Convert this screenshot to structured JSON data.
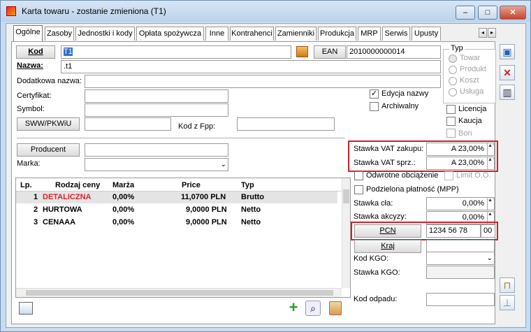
{
  "window": {
    "title": "Karta towaru - zostanie zmieniona (T1)",
    "minimize": "‒",
    "maximize": "□",
    "close": "✕"
  },
  "tabs": [
    "Ogólne",
    "Zasoby",
    "Jednostki i kody",
    "Opłata spożywcza",
    "Inne",
    "Kontrahenci",
    "Zamienniki",
    "Produkcja",
    "MRP",
    "Serwis",
    "Upusty"
  ],
  "tab_scroll": {
    "left": "◂",
    "right": "▸"
  },
  "form": {
    "kod_button": "Kod",
    "kod_value": "T1",
    "ean_button": "EAN",
    "ean_value": "2010000000014",
    "nazwa_label": "Nazwa:",
    "nazwa_value": ".t1",
    "dodatkowa_label": "Dodatkowa nazwa:",
    "certyfikat_label": "Certyfikat:",
    "symbol_label": "Symbol:",
    "sww_button": "SWW/PKWiU",
    "kod_fpp_label": "Kod z Fpp:",
    "edycja_label": "Edycja nazwy",
    "edycja_checked": "✓",
    "archiwalny_label": "Archiwalny",
    "producent_button": "Producent",
    "marka_label": "Marka:"
  },
  "typ": {
    "title": "Typ",
    "options": [
      "Towar",
      "Produkt",
      "Koszt",
      "Usługa"
    ]
  },
  "flags": [
    "Licencja",
    "Kaucja",
    "Bon"
  ],
  "vat": {
    "zakup_label": "Stawka VAT zakupu:",
    "zakup_value": "A 23,00%",
    "sprz_label": "Stawka VAT sprz.:",
    "sprz_value": "A 23,00%",
    "odwrotne_label": "Odwrotne obciążenie",
    "limit_label": "Limit O.O.",
    "podzielona_label": "Podzielona płatność (MPP)",
    "cla_label": "Stawka cła:",
    "cla_value": "0,00%",
    "akcyzy_label": "Stawka akcyzy:",
    "akcyzy_value": "0,00%",
    "pcn_button": "PCN",
    "pcn_value": "1234 56 78",
    "pcn_suffix": "00",
    "kraj_button": "Kraj",
    "kod_kgo_label": "Kod KGO:",
    "stawka_kgo_label": "Stawka KGO:",
    "kod_odpadu_label": "Kod odpadu:"
  },
  "grid": {
    "headers": [
      "Lp.",
      "Rodzaj ceny",
      "Marża",
      "Price",
      "Typ"
    ],
    "rows": [
      {
        "lp": "1",
        "rodzaj": "DETALICZNA",
        "marza": "0,00%",
        "price": "11,0700 PLN",
        "typ": "Brutto"
      },
      {
        "lp": "2",
        "rodzaj": "HURTOWA",
        "marza": "0,00%",
        "price": "9,0000 PLN",
        "typ": "Netto"
      },
      {
        "lp": "3",
        "rodzaj": "CENAAA",
        "marza": "0,00%",
        "price": "9,0000 PLN",
        "typ": "Netto"
      }
    ]
  },
  "colors": {
    "accent_red": "#d0212a",
    "detaliczna": "#e0202a"
  }
}
